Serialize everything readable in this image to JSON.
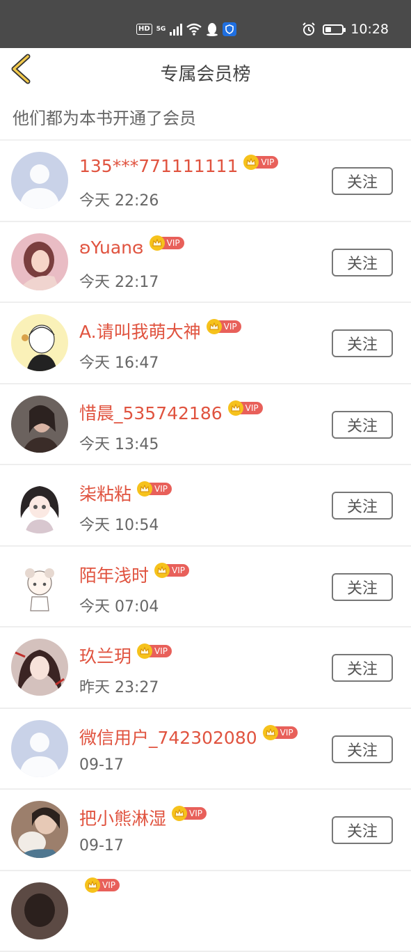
{
  "status_bar": {
    "time": "10:28",
    "battery_level": 0.45
  },
  "nav": {
    "title": "专属会员榜"
  },
  "subtitle": "他们都为本书开通了会员",
  "vip_label": "VIP",
  "follow_label": "关注",
  "members": [
    {
      "name": "135***771111111",
      "time": "今天 22:26",
      "avatar": "default"
    },
    {
      "name": "ʚYuanɞ",
      "time": "今天 22:17",
      "avatar": "photo-pink"
    },
    {
      "name": "A.请叫我萌大神",
      "time": "今天 16:47",
      "avatar": "cartoon-yellow"
    },
    {
      "name": "惜晨_535742186",
      "time": "今天 13:45",
      "avatar": "photo-dark"
    },
    {
      "name": "柒粘粘",
      "time": "今天 10:54",
      "avatar": "anime-girl"
    },
    {
      "name": "陌年浅时",
      "time": "今天 07:04",
      "avatar": "sketch-girl"
    },
    {
      "name": "玖兰玥",
      "time": "昨天 23:27",
      "avatar": "anime-red"
    },
    {
      "name": "微信用户_742302080",
      "time": "09-17",
      "avatar": "default"
    },
    {
      "name": "把小熊淋湿",
      "time": "09-17",
      "avatar": "photo-cat"
    },
    {
      "name": "",
      "time": "",
      "avatar": "photo-partial"
    }
  ]
}
